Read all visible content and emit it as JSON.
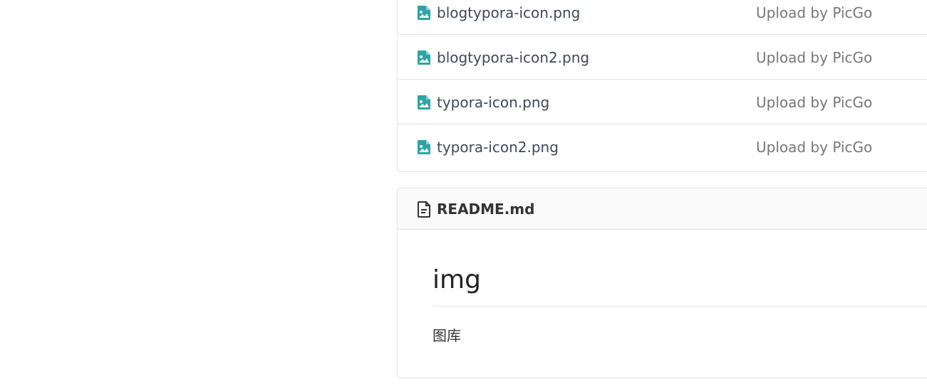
{
  "files": [
    {
      "name": "blogtypora-icon.png",
      "commit": "Upload by PicGo",
      "icon": "image-file-icon"
    },
    {
      "name": "blogtypora-icon2.png",
      "commit": "Upload by PicGo",
      "icon": "image-file-icon"
    },
    {
      "name": "typora-icon.png",
      "commit": "Upload by PicGo",
      "icon": "image-file-icon"
    },
    {
      "name": "typora-icon2.png",
      "commit": "Upload by PicGo",
      "icon": "image-file-icon"
    }
  ],
  "readme": {
    "filename": "README.md",
    "icon": "document-icon",
    "heading": "img",
    "paragraph": "图库"
  },
  "colors": {
    "file_icon": "#2ea4a4",
    "border": "#e3e3e3",
    "header_bg": "#fafafa",
    "commit_text": "#777777"
  }
}
